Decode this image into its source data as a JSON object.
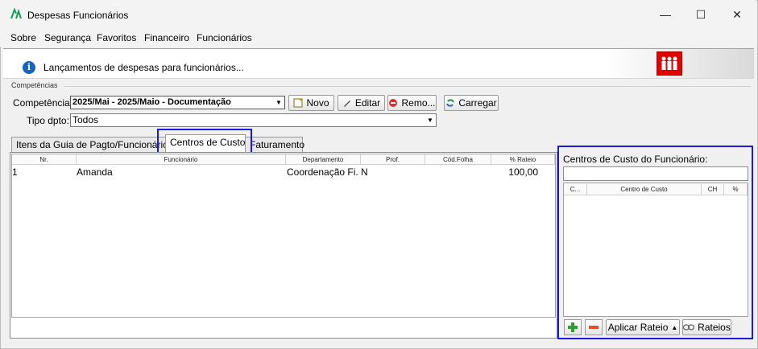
{
  "window": {
    "title": "Despesas Funcionários",
    "minimize": "—",
    "maximize": "☐",
    "close": "✕"
  },
  "menu": [
    {
      "label": "Sobre"
    },
    {
      "label": "Segurança"
    },
    {
      "label": "Favoritos"
    },
    {
      "label": "Financeiro"
    },
    {
      "label": "Funcionários"
    }
  ],
  "info": {
    "text": "Lançamentos de despesas para funcionários...",
    "icon": "info-icon",
    "badge_icon": "people-icon"
  },
  "section": {
    "title": "Competências"
  },
  "form": {
    "competencia_label": "Competência:",
    "competencia_value": "2025/Mai - 2025/Maio - Documentação",
    "tipo_label": "Tipo dpto:",
    "tipo_value": "Todos"
  },
  "toolbar": {
    "novo": "Novo",
    "editar": "Editar",
    "remover": "Remo...",
    "carregar": "Carregar"
  },
  "tabs": [
    {
      "label": "Itens da Guia de Pagto/Funcionários"
    },
    {
      "label": "Centros de Custo",
      "active": true
    },
    {
      "label": "Faturamento"
    }
  ],
  "table": {
    "columns": [
      "Nr.",
      "Funcionário",
      "Departamento",
      "Prof.",
      "Cód.Folha",
      "% Rateio"
    ],
    "rows": [
      {
        "nr": "1",
        "funcionario": "Amanda",
        "departamento": "Coordenação Fi...",
        "prof": "N",
        "cod_folha": "",
        "rateio": "100,00"
      }
    ]
  },
  "side_panel": {
    "title": "Centros de Custo do Funcionário:",
    "search_value": "",
    "columns": [
      "C...",
      "Centro de Custo",
      "CH",
      "%"
    ],
    "add_icon": "plus-icon",
    "remove_icon": "minus-icon",
    "aplicar_label": "Aplicar Rateio",
    "rateios_label": "Rateios"
  },
  "colors": {
    "highlight": "#1a1ae6",
    "accent": "#1565c0",
    "badge": "#e00000"
  }
}
